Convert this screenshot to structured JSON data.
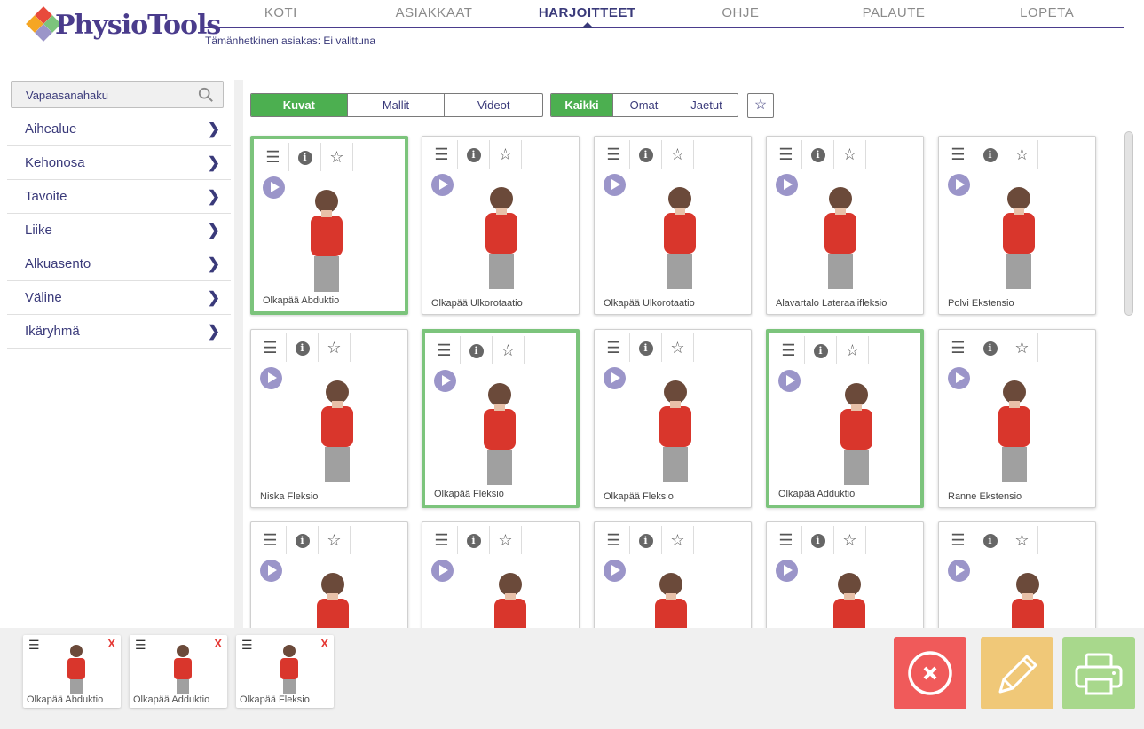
{
  "brand": {
    "logo_text": "PhysioTools"
  },
  "nav": {
    "items": [
      "KOTI",
      "ASIAKKAAT",
      "HARJOITTEET",
      "OHJE",
      "PALAUTE",
      "LOPETA"
    ],
    "active_index": 2
  },
  "client_text": "Tämänhetkinen asiakas: Ei valittuna",
  "search": {
    "placeholder": "Vapaasanahaku"
  },
  "filters": [
    "Aihealue",
    "Kehonosa",
    "Tavoite",
    "Liike",
    "Alkuasento",
    "Väline",
    "Ikäryhmä"
  ],
  "media_toggle": {
    "options": [
      "Kuvat",
      "Mallit",
      "Videot"
    ],
    "selected": "Kuvat"
  },
  "owner_toggle": {
    "options": [
      "Kaikki",
      "Omat",
      "Jaetut"
    ],
    "selected": "Kaikki"
  },
  "exercises": [
    {
      "name": "Olkapää Abduktio",
      "selected": true
    },
    {
      "name": "Olkapää Ulkorotaatio",
      "selected": false
    },
    {
      "name": "Olkapää Ulkorotaatio",
      "selected": false
    },
    {
      "name": "Alavartalo Lateraalifleksio",
      "selected": false
    },
    {
      "name": "Polvi Ekstensio",
      "selected": false
    },
    {
      "name": "Niska Fleksio",
      "selected": false
    },
    {
      "name": "Olkapää Fleksio",
      "selected": true
    },
    {
      "name": "Olkapää Fleksio",
      "selected": false
    },
    {
      "name": "Olkapää Adduktio",
      "selected": true
    },
    {
      "name": "Ranne Ekstensio",
      "selected": false
    },
    {
      "name": "",
      "selected": false
    },
    {
      "name": "",
      "selected": false
    },
    {
      "name": "",
      "selected": false
    },
    {
      "name": "",
      "selected": false
    },
    {
      "name": "",
      "selected": false
    }
  ],
  "tray": {
    "items": [
      {
        "name": "Olkapää Abduktio",
        "remove": "X"
      },
      {
        "name": "Olkapää Adduktio",
        "remove": "X"
      },
      {
        "name": "Olkapää Fleksio",
        "remove": "X"
      }
    ]
  },
  "colors": {
    "accent_green": "#4caf50",
    "selected_border": "#7cc47c",
    "brand_purple": "#4a3c8c",
    "clear_red": "#f05a5a",
    "edit_yellow": "#f0c878",
    "print_green": "#a8d88c"
  }
}
